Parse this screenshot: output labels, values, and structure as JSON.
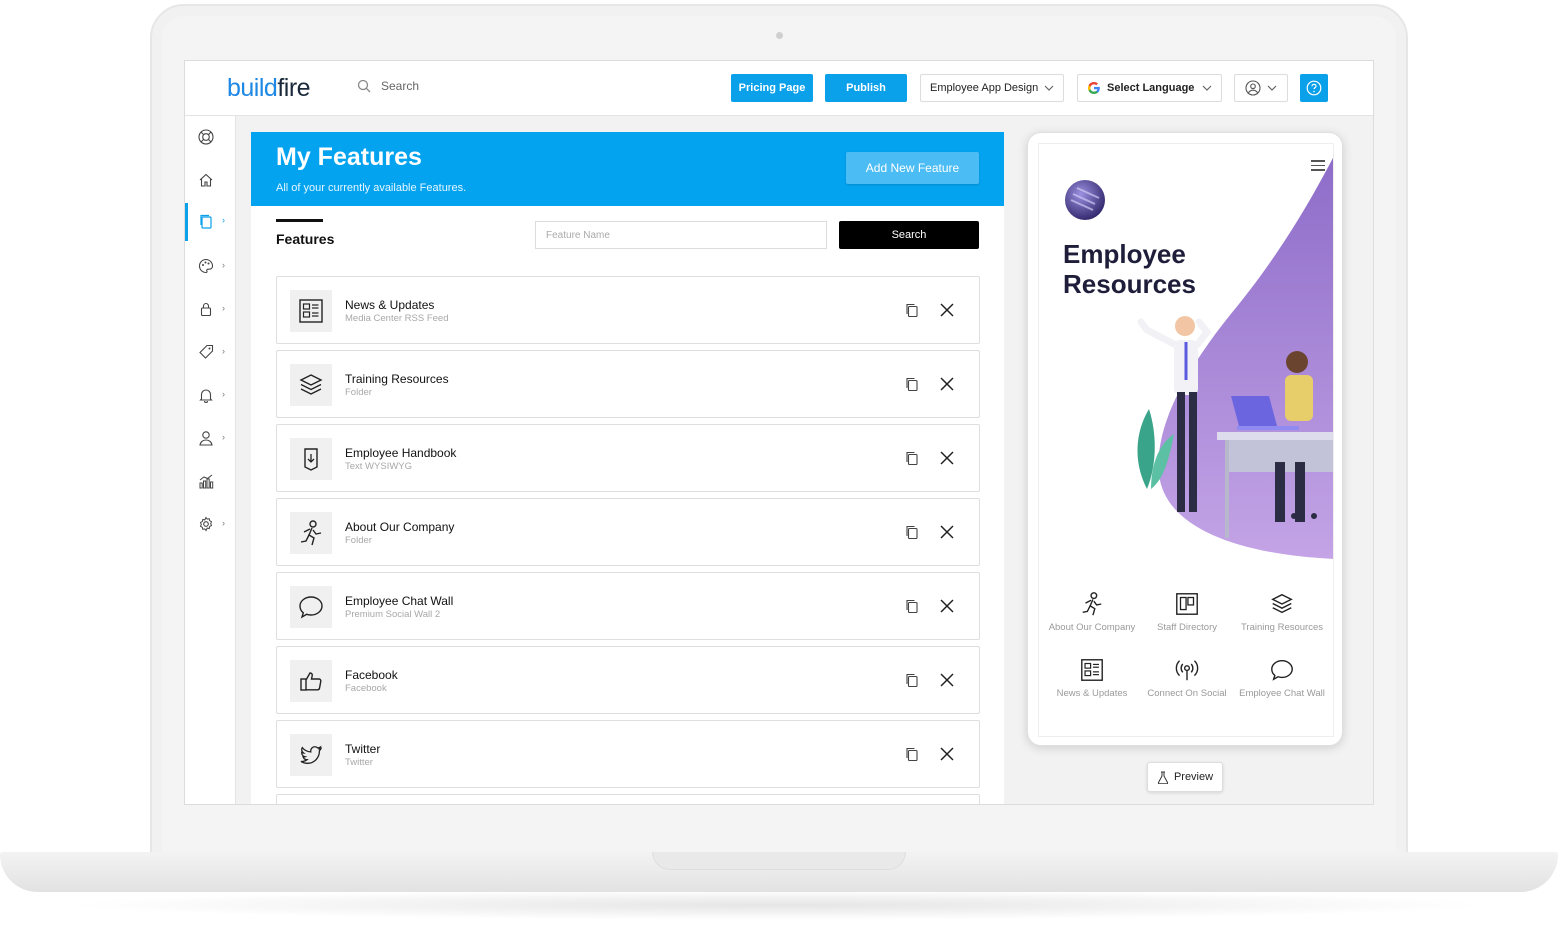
{
  "app": {
    "logo_part1": "build",
    "logo_part2": "fire",
    "search_label": "Search",
    "pricing_button": "Pricing Page",
    "publish_button": "Publish",
    "app_selector": "Employee App Design",
    "language_selector": "Select Language",
    "accent_color": "#03a3f0"
  },
  "sidebar": {
    "items": [
      {
        "icon": "lifebuoy-icon"
      },
      {
        "icon": "home-icon"
      },
      {
        "icon": "copy-features-icon",
        "active": true
      },
      {
        "icon": "palette-icon"
      },
      {
        "icon": "lock-icon"
      },
      {
        "icon": "tag-icon"
      },
      {
        "icon": "bell-icon"
      },
      {
        "icon": "user-icon"
      },
      {
        "icon": "analytics-icon"
      },
      {
        "icon": "gear-icon"
      }
    ]
  },
  "main": {
    "title": "My Features",
    "subtitle": "All of your currently available Features.",
    "add_button": "Add New Feature",
    "tab_label": "Features",
    "search_placeholder": "Feature Name",
    "search_button": "Search",
    "features": [
      {
        "name": "News & Updates",
        "type": "Media Center RSS Feed",
        "icon": "newspaper-icon"
      },
      {
        "name": "Training Resources",
        "type": "Folder",
        "icon": "layers-icon"
      },
      {
        "name": "Employee Handbook",
        "type": "Text WYSIWYG",
        "icon": "document-icon"
      },
      {
        "name": "About Our Company",
        "type": "Folder",
        "icon": "running-person-icon"
      },
      {
        "name": "Employee Chat Wall",
        "type": "Premium Social Wall 2",
        "icon": "chat-bubble-icon"
      },
      {
        "name": "Facebook",
        "type": "Facebook",
        "icon": "thumbs-up-icon"
      },
      {
        "name": "Twitter",
        "type": "Twitter",
        "icon": "twitter-bird-icon"
      }
    ]
  },
  "phone": {
    "title": "Employee Resources",
    "grid": [
      {
        "label": "About Our Company",
        "icon": "running-person-icon"
      },
      {
        "label": "Staff Directory",
        "icon": "board-icon"
      },
      {
        "label": "Training Resources",
        "icon": "layers-icon"
      },
      {
        "label": "News & Updates",
        "icon": "newspaper-icon"
      },
      {
        "label": "Connect On Social",
        "icon": "broadcast-icon"
      },
      {
        "label": "Employee Chat Wall",
        "icon": "chat-bubble-icon"
      }
    ],
    "preview_button": "Preview"
  }
}
